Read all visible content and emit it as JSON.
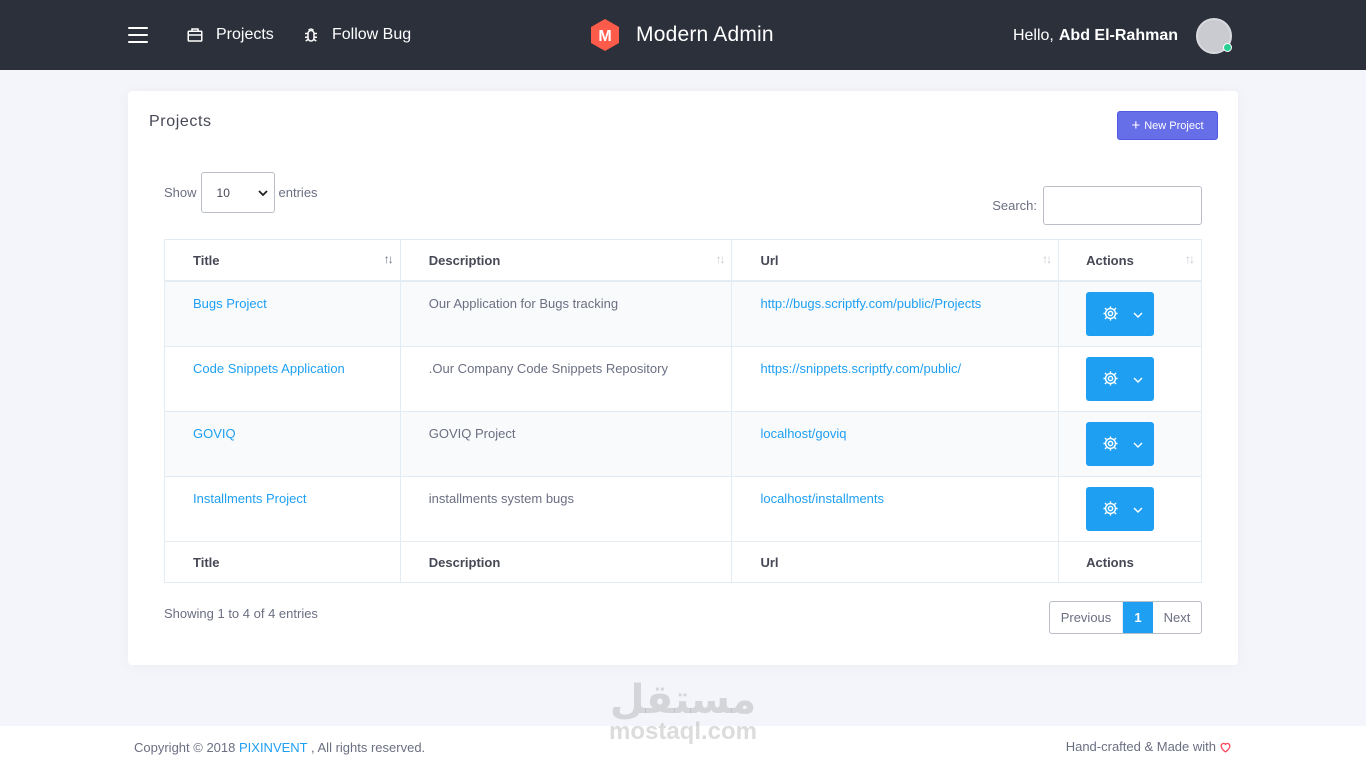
{
  "header": {
    "menu_icon": "hamburger-icon",
    "nav": [
      {
        "label": "Projects",
        "icon": "briefcase-icon"
      },
      {
        "label": "Follow Bug",
        "icon": "bug-icon"
      }
    ],
    "brand": {
      "logo_letter": "M",
      "name": "Modern Admin",
      "logo_color": "#ff5b4a"
    },
    "user": {
      "greeting": "Hello,",
      "name": "Abd El-Rahman",
      "status_color": "#28d094"
    }
  },
  "card": {
    "title": "Projects",
    "new_button": "New Project",
    "length": {
      "show": "Show",
      "value": "10",
      "entries": "entries"
    },
    "search": {
      "label": "Search:",
      "value": ""
    },
    "columns": [
      "Title",
      "Description",
      "Url",
      "Actions"
    ],
    "rows": [
      {
        "title": "Bugs Project",
        "description": "Our Application for Bugs tracking",
        "url": "http://bugs.scriptfy.com/public/Projects"
      },
      {
        "title": "Code Snippets Application",
        "description": ".Our Company Code Snippets Repository",
        "url": "https://snippets.scriptfy.com/public/"
      },
      {
        "title": "GOVIQ",
        "description": "GOVIQ Project",
        "url": "localhost/goviq"
      },
      {
        "title": "Installments Project",
        "description": "installments system bugs",
        "url": "localhost/installments"
      }
    ],
    "info": "Showing 1 to 4 of 4 entries",
    "pagination": {
      "previous": "Previous",
      "current": "1",
      "next": "Next"
    },
    "accent_color": "#1e9ff2",
    "button_color": "#666ee8"
  },
  "footer": {
    "copyright_prefix": "Copyright © 2018",
    "company": "PIXINVENT",
    "copyright_suffix": ", All rights reserved.",
    "made": "Hand-crafted & Made with"
  },
  "watermark": {
    "arabic": "مستقل",
    "latin": "mostaql.com"
  }
}
